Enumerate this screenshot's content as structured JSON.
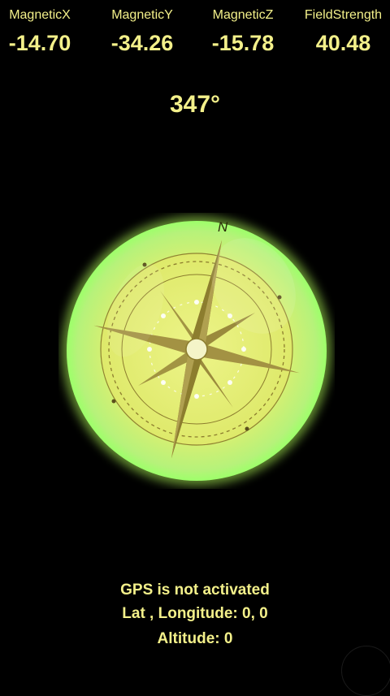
{
  "sensors": [
    {
      "label": "MagneticX",
      "value": "-14.70"
    },
    {
      "label": "MagneticY",
      "value": "-34.26"
    },
    {
      "label": "MagneticZ",
      "value": "-15.78"
    },
    {
      "label": "FieldStrength",
      "value": "40.48"
    }
  ],
  "heading": "347°",
  "compass": {
    "north_label": "N",
    "icon": "compass-rose-icon",
    "colors": {
      "glow": "#c8ff7a",
      "face": "#e9f58a",
      "needle": "#8c7d2e",
      "text": "#f3f08a"
    }
  },
  "gps": {
    "status": "GPS is not activated",
    "latlon": "Lat , Longitude:  0,  0",
    "altitude": "Altitude:  0"
  }
}
